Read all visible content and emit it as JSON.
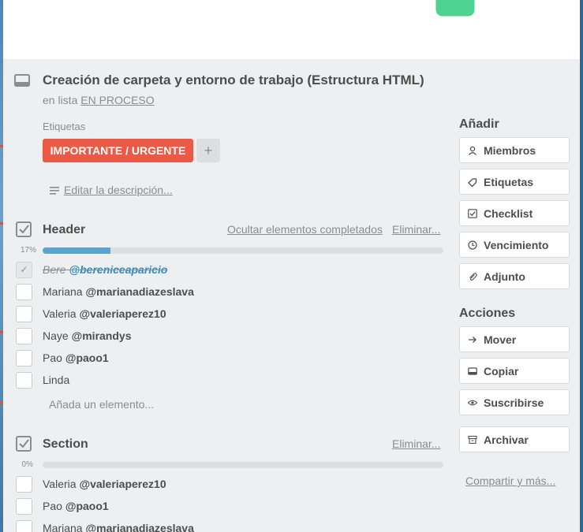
{
  "card": {
    "title": "Creación de carpeta y entorno de trabajo (Estructura HTML)",
    "in_list_prefix": "en lista",
    "list_name": "EN PROCESO"
  },
  "labels": {
    "heading": "Etiquetas",
    "items": [
      {
        "text": "IMPORTANTE / URGENTE",
        "color": "#eb5a46"
      }
    ],
    "add": "+"
  },
  "description": {
    "edit_link": "Editar la descripción..."
  },
  "checklists": [
    {
      "title": "Header",
      "hide_completed": "Ocultar elementos completados",
      "delete": "Eliminar...",
      "percent": "17%",
      "progress": 0.17,
      "items": [
        {
          "name": "Bere",
          "mention": "@bereniceaparicio",
          "done": true
        },
        {
          "name": "Mariana",
          "mention": "@marianadiazeslava",
          "done": false
        },
        {
          "name": "Valeria",
          "mention": "@valeriaperez10",
          "done": false
        },
        {
          "name": "Naye",
          "mention": "@mirandys",
          "done": false
        },
        {
          "name": "Pao",
          "mention": "@paoo1",
          "done": false
        },
        {
          "name": "Linda",
          "mention": "",
          "done": false
        }
      ],
      "add_item": "Añada un elemento..."
    },
    {
      "title": "Section",
      "delete": "Eliminar...",
      "percent": "0%",
      "progress": 0,
      "items": [
        {
          "name": "Valeria",
          "mention": "@valeriaperez10",
          "done": false
        },
        {
          "name": "Pao",
          "mention": "@paoo1",
          "done": false
        },
        {
          "name": "Mariana",
          "mention": "@marianadiazeslava",
          "done": false
        }
      ]
    }
  ],
  "sidebar": {
    "add_heading": "Añadir",
    "add_buttons": [
      {
        "label": "Miembros",
        "icon": "member-icon"
      },
      {
        "label": "Etiquetas",
        "icon": "label-icon"
      },
      {
        "label": "Checklist",
        "icon": "checklist-icon"
      },
      {
        "label": "Vencimiento",
        "icon": "clock-icon"
      },
      {
        "label": "Adjunto",
        "icon": "attachment-icon"
      }
    ],
    "actions_heading": "Acciones",
    "action_buttons": [
      {
        "label": "Mover",
        "icon": "arrow-right-icon"
      },
      {
        "label": "Copiar",
        "icon": "copy-icon"
      },
      {
        "label": "Suscribirse",
        "icon": "eye-icon"
      },
      {
        "label": "Archivar",
        "icon": "archive-icon"
      }
    ],
    "share_link": "Compartir y más..."
  },
  "colors": {
    "accent": "#5ba4cf",
    "label_red": "#eb5a46",
    "mention_blue": "#2d8ec4"
  }
}
